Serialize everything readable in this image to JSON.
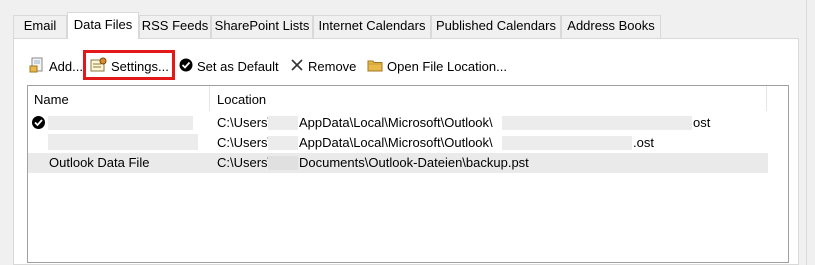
{
  "tabs": [
    {
      "label": "Email",
      "active": false
    },
    {
      "label": "Data Files",
      "active": true
    },
    {
      "label": "RSS Feeds",
      "active": false
    },
    {
      "label": "SharePoint Lists",
      "active": false
    },
    {
      "label": "Internet Calendars",
      "active": false
    },
    {
      "label": "Published Calendars",
      "active": false
    },
    {
      "label": "Address Books",
      "active": false
    }
  ],
  "toolbar": {
    "add": "Add...",
    "settings": "Settings...",
    "set_default": "Set as Default",
    "remove": "Remove",
    "open_location": "Open File Location..."
  },
  "list": {
    "columns": [
      "Name",
      "Location"
    ],
    "rows": [
      {
        "name": "",
        "default": true,
        "loc_parts": [
          "C:\\Users\\",
          "AppData\\Local\\Microsoft\\Outlook\\",
          "ost"
        ]
      },
      {
        "name": "",
        "default": false,
        "loc_parts": [
          "C:\\Users\\",
          "AppData\\Local\\Microsoft\\Outlook\\",
          ".ost"
        ]
      },
      {
        "name": "Outlook Data File",
        "default": false,
        "loc_parts": [
          "C:\\Users\\",
          "Documents\\Outlook-Dateien\\backup.pst"
        ]
      }
    ]
  },
  "colors": {
    "highlight": "#e31919",
    "selected_row": "#eaeaea",
    "folder": "#e8b84a"
  }
}
